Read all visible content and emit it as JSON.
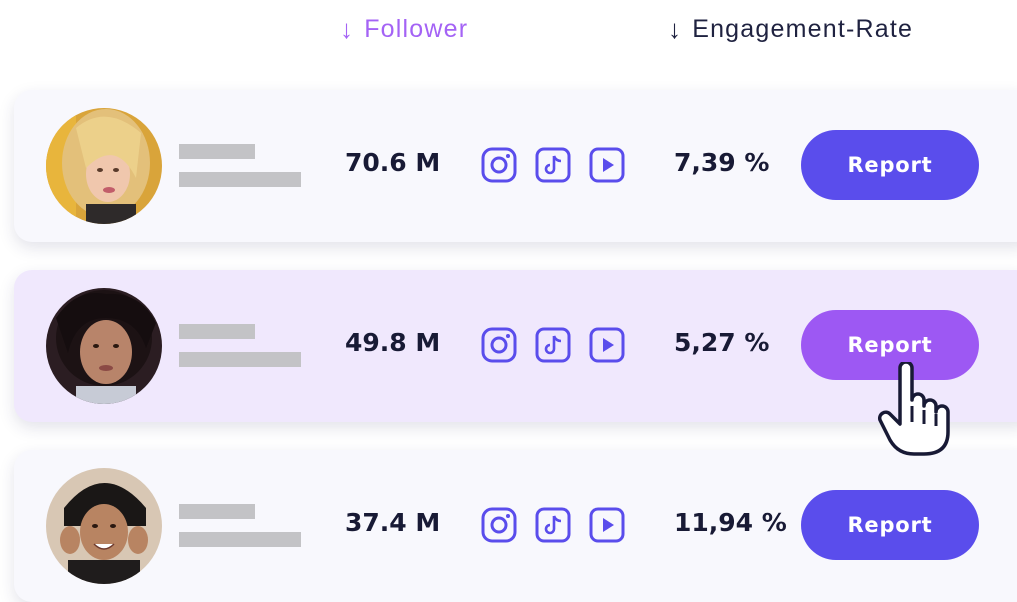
{
  "header": {
    "follower_label": "Follower",
    "engagement_label": "Engagement-Rate",
    "sort_arrow": "↓"
  },
  "colors": {
    "accent_purple": "#a463f5",
    "button_blue": "#5a4dec",
    "button_hover": "#9d58f3",
    "icon_color": "#5a4dec",
    "text_dark": "#181a35",
    "placeholder_gray": "#c3c3c6"
  },
  "influencers": [
    {
      "followers": "70.6 M",
      "engagement_rate": "7,39 %",
      "report_label": "Report",
      "platforms": [
        "instagram-icon",
        "tiktok-icon",
        "youtube-icon"
      ]
    },
    {
      "followers": "49.8 M",
      "engagement_rate": "5,27 %",
      "report_label": "Report",
      "platforms": [
        "instagram-icon",
        "tiktok-icon",
        "youtube-icon"
      ],
      "hovered": true
    },
    {
      "followers": "37.4 M",
      "engagement_rate": "11,94 %",
      "report_label": "Report",
      "platforms": [
        "instagram-icon",
        "tiktok-icon",
        "youtube-icon"
      ]
    }
  ]
}
